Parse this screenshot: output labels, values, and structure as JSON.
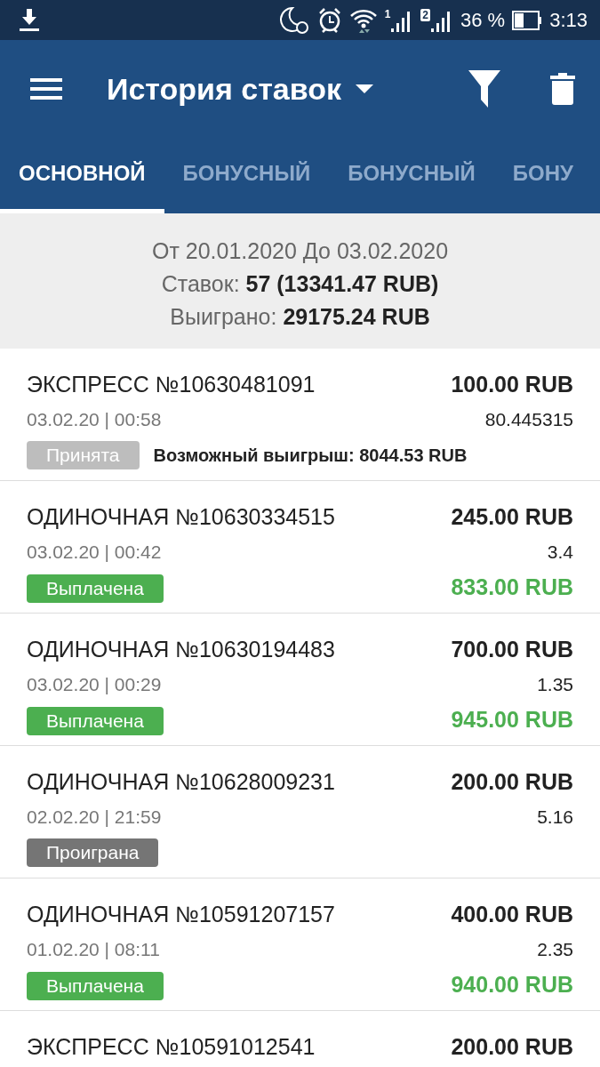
{
  "status_bar": {
    "sim_1": "1",
    "sim_2": "2",
    "battery": "36 %",
    "time": "3:13"
  },
  "app_bar": {
    "title": "История ставок"
  },
  "tabs": [
    {
      "label": "ОСНОВНОЙ",
      "selected": true
    },
    {
      "label": "БОНУСНЫЙ",
      "selected": false
    },
    {
      "label": "БОНУСНЫЙ",
      "selected": false
    },
    {
      "label": "БОНУ",
      "selected": false
    }
  ],
  "summary": {
    "period": "От 20.01.2020 До 03.02.2020",
    "bets": "Ставок: **57 (13341.47 RUB)**",
    "won": "Выиграно: **29175.24 RUB**"
  },
  "bets": [
    {
      "title": "ЭКСПРЕСС №10630481091",
      "datetime": "03.02.20 | 00:58",
      "amount": "100.00 RUB",
      "odds": "80.445315",
      "status": {
        "label": "Принята",
        "kind": "accepted"
      },
      "note": "Возможный выигрыш: 8044.53 RUB"
    },
    {
      "title": "ОДИНОЧНАЯ №10630334515",
      "datetime": "03.02.20 | 00:42",
      "amount": "245.00 RUB",
      "odds": "3.4",
      "status": {
        "label": "Выплачена",
        "kind": "paid"
      },
      "payout": "833.00 RUB"
    },
    {
      "title": "ОДИНОЧНАЯ №10630194483",
      "datetime": "03.02.20 | 00:29",
      "amount": "700.00 RUB",
      "odds": "1.35",
      "status": {
        "label": "Выплачена",
        "kind": "paid"
      },
      "payout": "945.00 RUB"
    },
    {
      "title": "ОДИНОЧНАЯ №10628009231",
      "datetime": "02.02.20 | 21:59",
      "amount": "200.00 RUB",
      "odds": "5.16",
      "status": {
        "label": "Проиграна",
        "kind": "lost"
      }
    },
    {
      "title": "ОДИНОЧНАЯ №10591207157",
      "datetime": "01.02.20 | 08:11",
      "amount": "400.00 RUB",
      "odds": "2.35",
      "status": {
        "label": "Выплачена",
        "kind": "paid"
      },
      "payout": "940.00 RUB"
    },
    {
      "title": "ЭКСПРЕСС №10591012541",
      "amount": "200.00 RUB"
    }
  ]
}
